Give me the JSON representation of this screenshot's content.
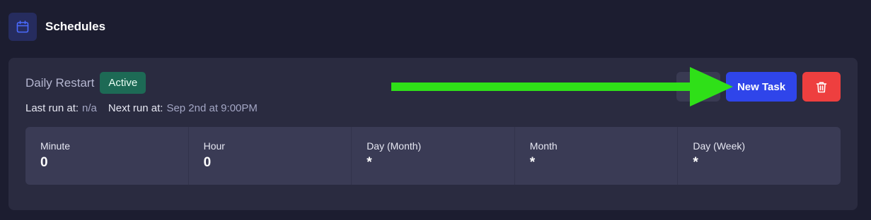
{
  "header": {
    "icon": "calendar-icon",
    "title": "Schedules"
  },
  "schedule": {
    "name": "Daily Restart",
    "status": "Active",
    "last_run_label": "Last run at:",
    "last_run_value": "n/a",
    "next_run_label": "Next run at:",
    "next_run_value": "Sep 2nd at 9:00PM"
  },
  "actions": {
    "new_task_label": "New Task",
    "delete_icon": "trash-icon"
  },
  "cron": [
    {
      "label": "Minute",
      "value": "0"
    },
    {
      "label": "Hour",
      "value": "0"
    },
    {
      "label": "Day (Month)",
      "value": "*"
    },
    {
      "label": "Month",
      "value": "*"
    },
    {
      "label": "Day (Week)",
      "value": "*"
    }
  ],
  "colors": {
    "background": "#1c1d30",
    "card": "#2a2b40",
    "status_active": "#1d6a55",
    "primary_button": "#2f45ea",
    "danger_button": "#ee3f3f",
    "annotation_arrow": "#2fe018"
  }
}
